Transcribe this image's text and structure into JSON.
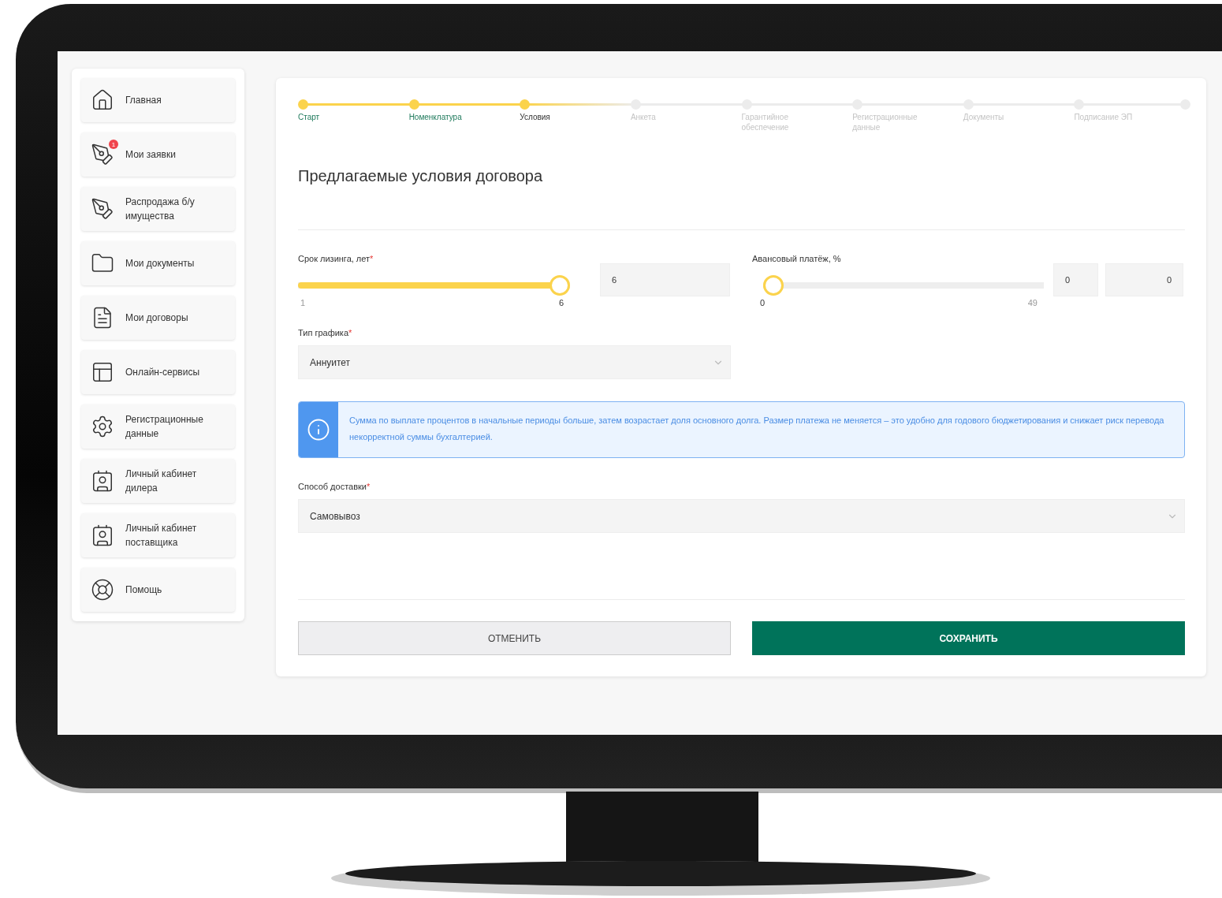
{
  "sidebar": {
    "items": [
      {
        "label": "Главная",
        "selected": false
      },
      {
        "label": "Мои заявки",
        "selected": false,
        "badge": "1"
      },
      {
        "label": "Распродажа б/у имущества",
        "selected": false
      },
      {
        "label": "Мои документы",
        "selected": false
      },
      {
        "label": "Мои договоры",
        "selected": false
      },
      {
        "label": "Онлайн-сервисы",
        "selected": false
      },
      {
        "label": "Регистрационные данные",
        "selected": false
      },
      {
        "label": "Личный кабинет дилера",
        "selected": false
      },
      {
        "label": "Личный кабинет поставщика",
        "selected": false
      },
      {
        "label": "Помощь",
        "selected": false
      }
    ]
  },
  "stepper": [
    {
      "label": "Старт",
      "completed": true,
      "selected": false
    },
    {
      "label": "Номенклатура",
      "completed": true,
      "selected": false
    },
    {
      "label": "Условия",
      "completed": true,
      "selected": true
    },
    {
      "label": "Анкета",
      "completed": false,
      "selected": false
    },
    {
      "label": "Гарантийное обеспечение",
      "completed": false,
      "selected": false
    },
    {
      "label": "Регистрационные данные",
      "completed": false,
      "selected": false
    },
    {
      "label": "Документы",
      "completed": false,
      "selected": false
    },
    {
      "label": "Подписание ЭП",
      "completed": false,
      "selected": false
    }
  ],
  "title": "Предлагаемые условия договора",
  "term": {
    "label": "Срок лизинга, лет",
    "required": "*",
    "level": 1,
    "min": "1",
    "max": "6",
    "value": "6"
  },
  "advance": {
    "label": "Авансовый платёж, %",
    "level": 0,
    "min": "0",
    "max": "49",
    "value": "0",
    "amount": "0"
  },
  "schedule": {
    "label": "Тип графика",
    "required": "*",
    "value": "Аннуитет"
  },
  "info": "Сумма по выплате процентов в начальные периоды больше, затем возрастает доля основного долга. Размер платежа не меняется – это удобно для годового бюджетирования и снижает риск перевода некорректной суммы бухгалтерией.",
  "delivery": {
    "label": "Способ доставки",
    "required": "*",
    "value": "Самовывоз"
  },
  "buttons": {
    "cancel": "ОТМЕНИТЬ",
    "save": "СОХРАНИТЬ"
  }
}
